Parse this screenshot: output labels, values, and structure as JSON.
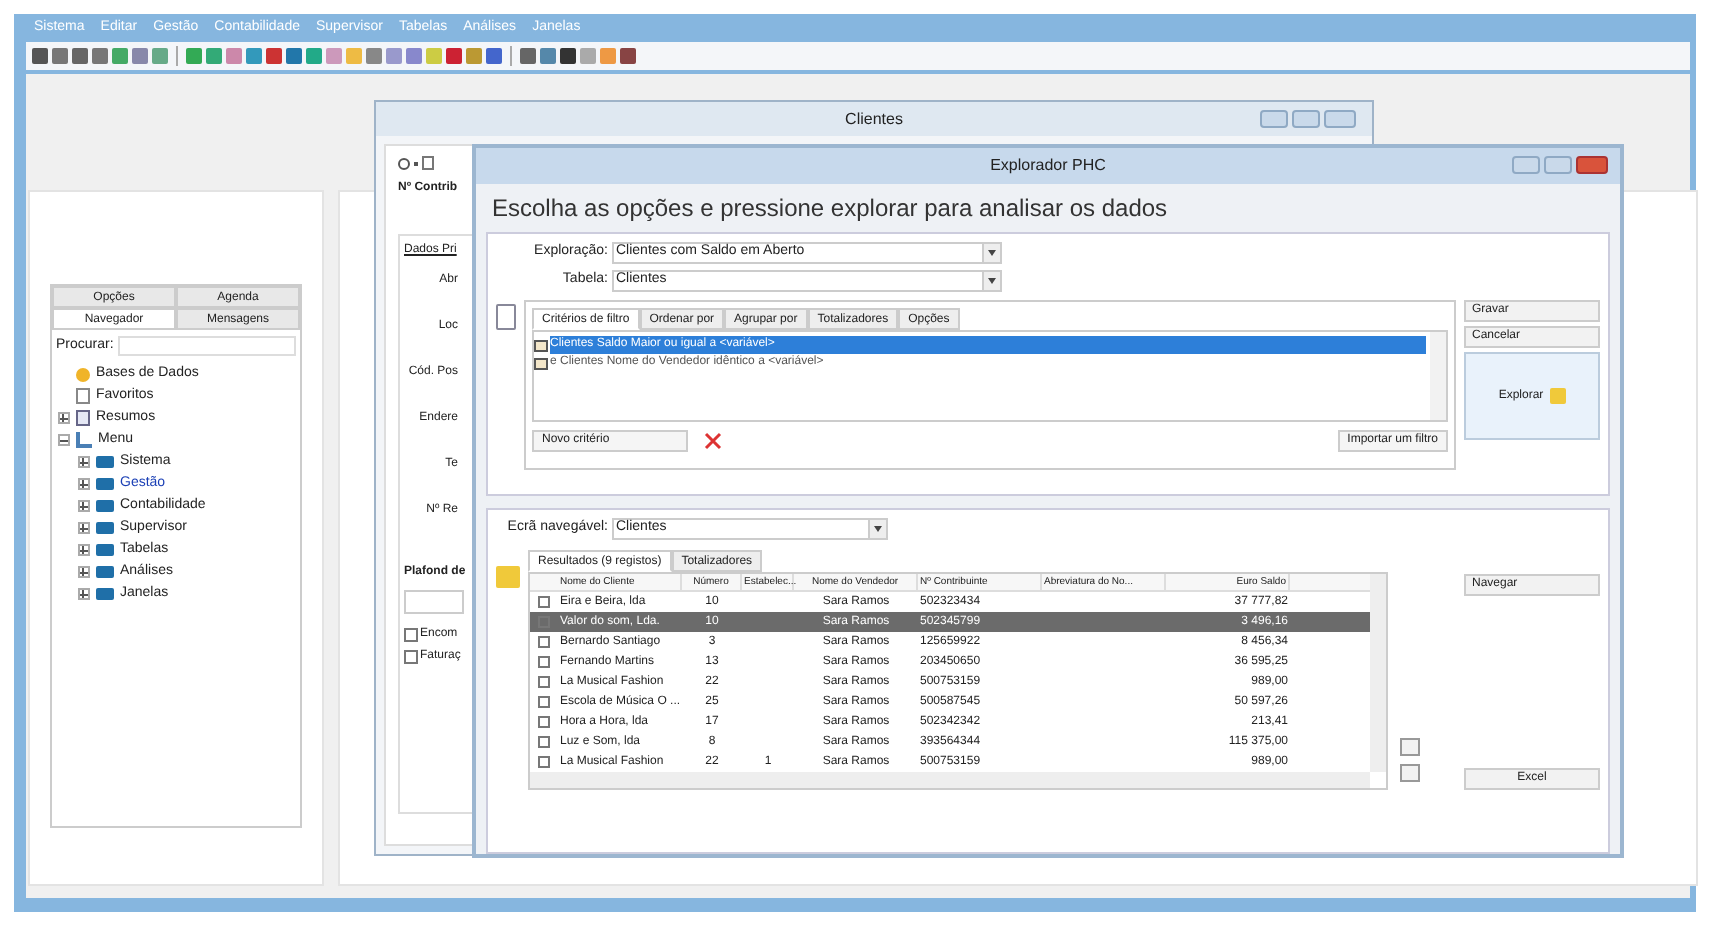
{
  "menu_bar": [
    "Sistema",
    "Editar",
    "Gestão",
    "Contabilidade",
    "Supervisor",
    "Tabelas",
    "Análises",
    "Janelas"
  ],
  "side_panel": {
    "tabs": [
      {
        "label": "Opções",
        "selected": false
      },
      {
        "label": "Agenda",
        "selected": false
      },
      {
        "label": "Navegador",
        "selected": true
      },
      {
        "label": "Mensagens",
        "selected": false
      }
    ],
    "search_label": "Procurar:",
    "tree": [
      {
        "label": "Bases de Dados",
        "kind": "database",
        "selected": false
      },
      {
        "label": "Favoritos",
        "kind": "favorites",
        "selected": false
      },
      {
        "label": "Resumos",
        "kind": "summary",
        "expanded": false,
        "selected": false
      },
      {
        "label": "Menu",
        "kind": "menu",
        "expanded": true,
        "selected": false,
        "children": [
          {
            "label": "Sistema",
            "kind": "folder",
            "expanded": false,
            "selected": false
          },
          {
            "label": "Gestão",
            "kind": "folder",
            "expanded": false,
            "selected": true
          },
          {
            "label": "Contabilidade",
            "kind": "folder",
            "expanded": false,
            "selected": false
          },
          {
            "label": "Supervisor",
            "kind": "folder",
            "expanded": false,
            "selected": false
          },
          {
            "label": "Tabelas",
            "kind": "folder",
            "expanded": false,
            "selected": false
          },
          {
            "label": "Análises",
            "kind": "folder",
            "expanded": false,
            "selected": false
          },
          {
            "label": "Janelas",
            "kind": "folder",
            "expanded": false,
            "selected": false
          }
        ]
      }
    ]
  },
  "clientes_window": {
    "title": "Clientes",
    "toolbar_label": "Nº Contrib",
    "section_label": "Dados Pri",
    "form_labels": [
      "Abr",
      "Loc",
      "Cód. Pos",
      "Endere",
      "Te",
      "Nº Re"
    ],
    "plafond_label": "Plafond de",
    "checkboxes": [
      {
        "label": "Encom",
        "checked": false
      },
      {
        "label": "Faturaç",
        "checked": false
      }
    ]
  },
  "explorer_window": {
    "title": "Explorador PHC",
    "heading": "Escolha as opções e pressione explorar para analisar os dados",
    "exploration": {
      "label": "Exploração:",
      "value": "Clientes com Saldo em Aberto"
    },
    "table": {
      "label": "Tabela:",
      "value": "Clientes"
    },
    "tabs": [
      {
        "label": "Critérios de filtro",
        "selected": true
      },
      {
        "label": "Ordenar por",
        "selected": false
      },
      {
        "label": "Agrupar por",
        "selected": false
      },
      {
        "label": "Totalizadores",
        "selected": false
      },
      {
        "label": "Opções",
        "selected": false
      }
    ],
    "criteria": [
      {
        "text": "Clientes Saldo Maior ou igual a <variável>",
        "selected": true
      },
      {
        "text": "e Clientes Nome do Vendedor idêntico a <variável>",
        "selected": false
      }
    ],
    "new_criterion_button": "Novo critério",
    "import_button": "Importar um filtro",
    "side_buttons": [
      "Gravar",
      "Cancelar"
    ],
    "explore_button": "Explorar",
    "screen": {
      "label": "Ecrã navegável:",
      "value": "Clientes"
    },
    "result_tabs": [
      {
        "label": "Resultados (9 registos)",
        "selected": true
      },
      {
        "label": "Totalizadores",
        "selected": false
      }
    ],
    "columns": [
      "Nome do Cliente",
      "Número",
      "Estabelec...",
      "Nome do Vendedor",
      "Nº Contribuinte",
      "Abreviatura do No...",
      "Euro Saldo"
    ],
    "rows": [
      {
        "cells": [
          "Eira e Beira, lda",
          "10",
          "",
          "Sara Ramos",
          "502323434",
          "",
          "37 777,82"
        ],
        "selected": false
      },
      {
        "cells": [
          "Valor do som, Lda.",
          "10",
          "",
          "Sara Ramos",
          "502345799",
          "",
          "3 496,16"
        ],
        "selected": true
      },
      {
        "cells": [
          "Bernardo Santiago",
          "3",
          "",
          "Sara Ramos",
          "125659922",
          "",
          "8 456,34"
        ],
        "selected": false
      },
      {
        "cells": [
          "Fernando Martins",
          "13",
          "",
          "Sara Ramos",
          "203450650",
          "",
          "36 595,25"
        ],
        "selected": false
      },
      {
        "cells": [
          "La Musical Fashion",
          "22",
          "",
          "Sara Ramos",
          "500753159",
          "",
          "989,00"
        ],
        "selected": false
      },
      {
        "cells": [
          "Escola de Música O ...",
          "25",
          "",
          "Sara Ramos",
          "500587545",
          "",
          "50 597,26"
        ],
        "selected": false
      },
      {
        "cells": [
          "Hora a Hora, lda",
          "17",
          "",
          "Sara Ramos",
          "502342342",
          "",
          "213,41"
        ],
        "selected": false
      },
      {
        "cells": [
          "Luz e Som, lda",
          "8",
          "",
          "Sara Ramos",
          "393564344",
          "",
          "115 375,00"
        ],
        "selected": false
      },
      {
        "cells": [
          "La Musical Fashion",
          "22",
          "1",
          "Sara Ramos",
          "500753159",
          "",
          "989,00"
        ],
        "selected": false
      }
    ],
    "navigate_button": "Navegar",
    "excel_button": "Excel"
  }
}
